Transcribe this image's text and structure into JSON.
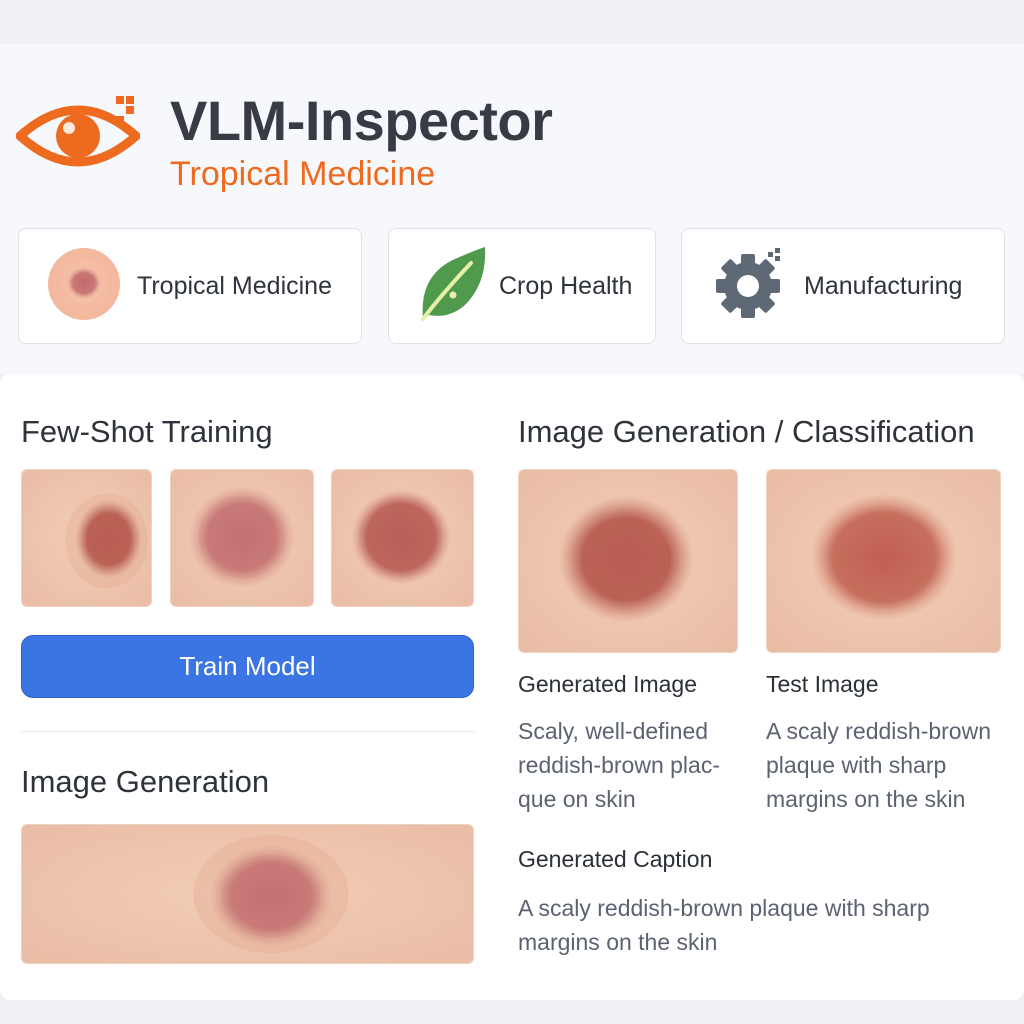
{
  "app": {
    "title": "VLM-Inspector",
    "subtitle": "Tropical Medicine",
    "logo_icon": "eye-icon",
    "accent_color": "#ee6a1f"
  },
  "domains": [
    {
      "label": "Tropical Medicine",
      "icon": "skin-lesion-icon"
    },
    {
      "label": "Crop Health",
      "icon": "leaf-icon"
    },
    {
      "label": "Manufacturing",
      "icon": "gear-icon"
    }
  ],
  "few_shot": {
    "title": "Few-Shot Training",
    "train_button_label": "Train Model",
    "button_color": "#3b74e3"
  },
  "image_generation": {
    "title": "Image Generation"
  },
  "classification": {
    "title": "Image Generation / Classification",
    "generated": {
      "label": "Generated Image",
      "description": "Scaly, well-defined reddish-brown plac-que on skin"
    },
    "test": {
      "label": "Test Image",
      "description": "A scaly reddish-brown plaque with sharp margins on the skin"
    },
    "caption": {
      "label": "Generated Caption",
      "text": "A scaly reddish-brown plaque with sharp margins on the skin"
    }
  }
}
